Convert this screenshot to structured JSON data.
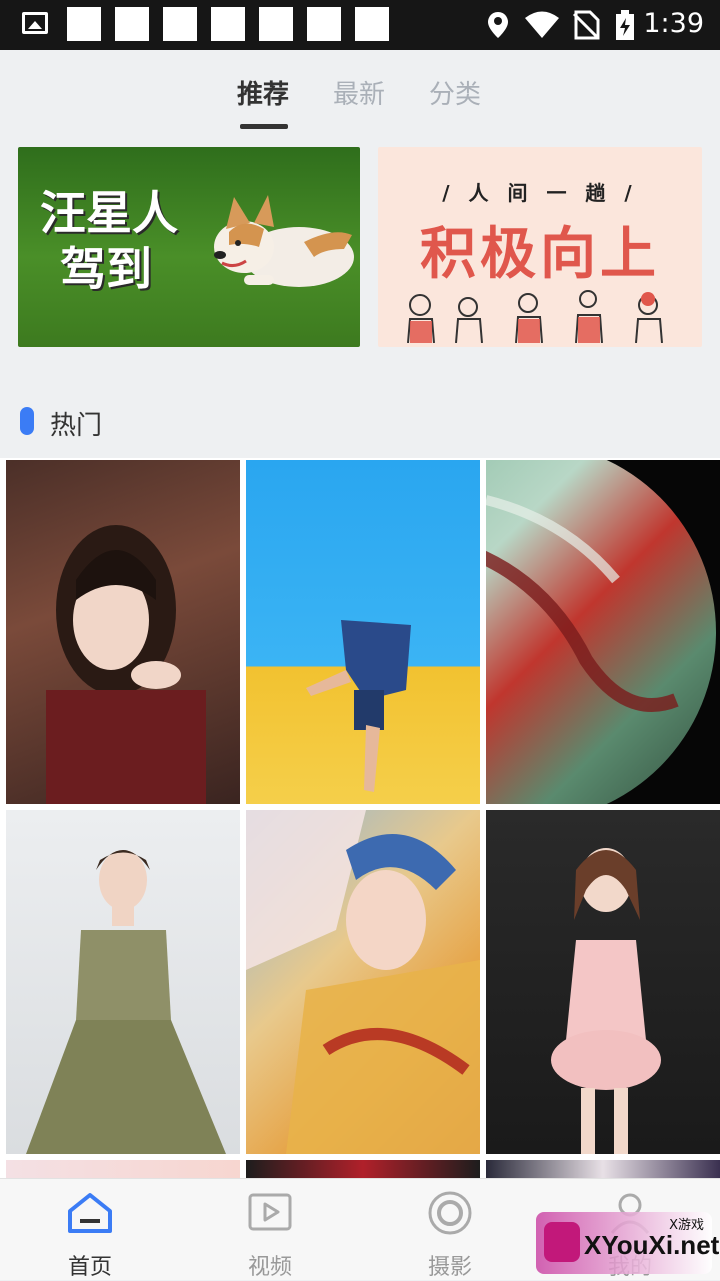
{
  "status": {
    "time": "1:39"
  },
  "tabs": {
    "recommend": "推荐",
    "latest": "最新",
    "category": "分类"
  },
  "banners": {
    "banner1_title_line1": "汪星人",
    "banner1_title_line2": "驾到",
    "banner2_subtitle": "/ 人 间 一 趟 /",
    "banner2_title": "积极向上"
  },
  "hot": {
    "title": "热门"
  },
  "nav": {
    "home": "首页",
    "video": "视频",
    "photo": "摄影",
    "mine": "我的"
  },
  "watermark": {
    "brand": "XYouXi.net",
    "small": "X游戏"
  },
  "colors": {
    "accent": "#3b7cf5",
    "text": "#333333"
  }
}
